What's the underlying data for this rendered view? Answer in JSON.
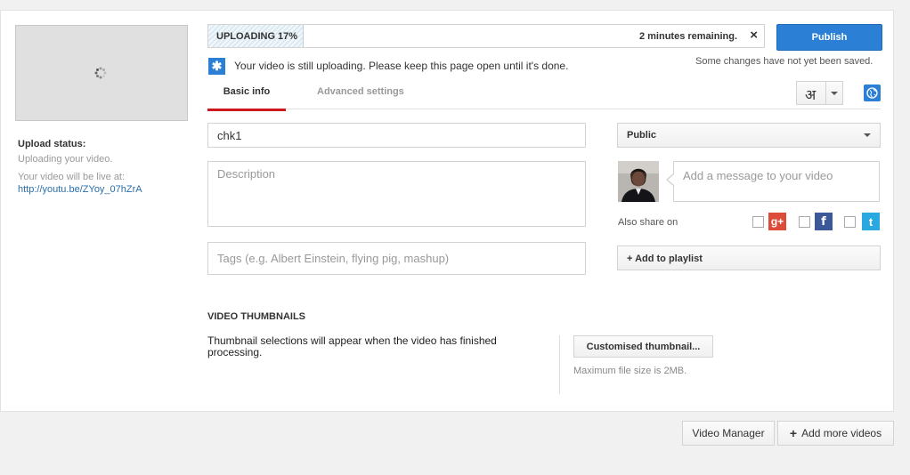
{
  "sidebar": {
    "upload_status_title": "Upload status:",
    "upload_status_text": "Uploading your video.",
    "live_at_label": "Your video will be live at:",
    "video_url": "http://youtu.be/ZYoy_07hZrA"
  },
  "progress": {
    "label": "UPLOADING 17%",
    "percent": 17,
    "remaining": "2 minutes remaining.",
    "cancel_glyph": "×"
  },
  "header": {
    "publish_label": "Publish",
    "save_note": "Some changes have not yet been saved."
  },
  "info": {
    "icon": "star-icon",
    "icon_glyph": "✱",
    "message": "Your video is still uploading. Please keep this page open until it's done."
  },
  "tabs": [
    {
      "label": "Basic info",
      "active": true
    },
    {
      "label": "Advanced settings",
      "active": false
    }
  ],
  "language": {
    "glyph": "अ"
  },
  "form": {
    "title_value": "chk1",
    "description_placeholder": "Description",
    "tags_placeholder": "Tags (e.g. Albert Einstein, flying pig, mashup)",
    "privacy_value": "Public",
    "message_placeholder": "Add a message to your video",
    "also_share_label": "Also share on",
    "social": {
      "gplus_glyph": "g+",
      "fb_glyph": "f",
      "tw_glyph": "t"
    },
    "add_playlist_label": "+ Add to playlist"
  },
  "thumbnails": {
    "heading": "VIDEO THUMBNAILS",
    "info": "Thumbnail selections will appear when the video has finished processing.",
    "custom_button_label": "Customised thumbnail...",
    "max_size_note": "Maximum file size is 2MB."
  },
  "footer": {
    "video_manager_label": "Video Manager",
    "add_more_plus": "+",
    "add_more_label": "Add more videos"
  },
  "colors": {
    "publish": "#2b80d6",
    "active_tab_underline": "#cc181e",
    "link": "#2a6ead",
    "gplus": "#dd4b39",
    "facebook": "#3b5998",
    "twitter": "#2aa9e0"
  }
}
